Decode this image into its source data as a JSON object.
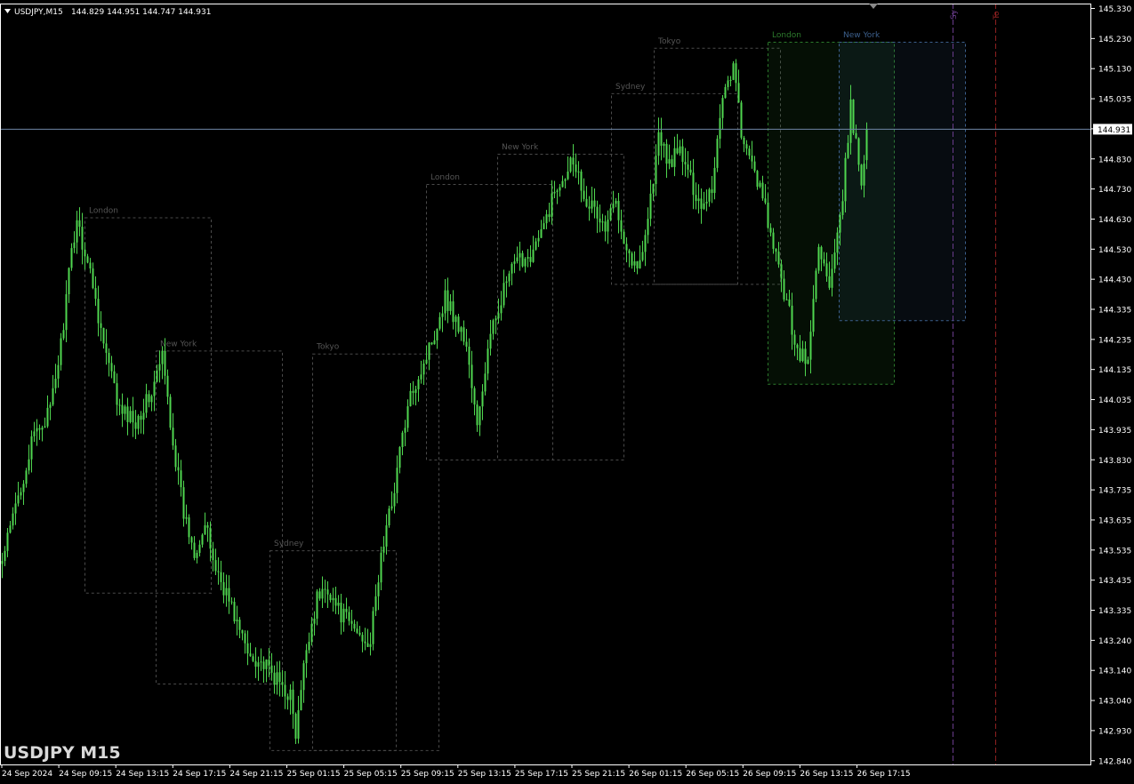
{
  "header": {
    "symbol_tf": "USDJPY,M15",
    "ohlc": "144.829 144.951 144.747 144.931"
  },
  "watermark": "USDJPY M15",
  "colors": {
    "background": "#000000",
    "candle": "#4fd64f",
    "grid_frame": "#ffffff",
    "price_line": "#6f86a6",
    "session_box": "#4a4a4a",
    "london_active": "#2c7a2c",
    "newyork_active": "#3c5f8c",
    "sydney_marker": "#6a3c8c",
    "tokyo_marker": "#8c2020"
  },
  "price_axis": {
    "labels": [
      "145.330",
      "145.230",
      "145.130",
      "145.035",
      "144.935",
      "144.830",
      "144.730",
      "144.630",
      "144.530",
      "144.430",
      "144.335",
      "144.235",
      "144.135",
      "144.035",
      "143.935",
      "143.830",
      "143.735",
      "143.635",
      "143.535",
      "143.435",
      "143.335",
      "143.240",
      "143.140",
      "143.040",
      "142.930",
      "142.840"
    ],
    "current_price": "144.931"
  },
  "time_axis": {
    "labels": [
      "24 Sep 2024",
      "24 Sep 09:15",
      "24 Sep 13:15",
      "24 Sep 17:15",
      "24 Sep 21:15",
      "25 Sep 01:15",
      "25 Sep 05:15",
      "25 Sep 09:15",
      "25 Sep 13:15",
      "25 Sep 17:15",
      "25 Sep 21:15",
      "26 Sep 01:15",
      "26 Sep 05:15",
      "26 Sep 09:15",
      "26 Sep 13:15",
      "26 Sep 17:15"
    ]
  },
  "sessions": [
    {
      "name": "London",
      "high": 144.64,
      "low": 143.4,
      "state": "past"
    },
    {
      "name": "New York",
      "high": 144.2,
      "low": 143.1,
      "state": "past"
    },
    {
      "name": "Sydney",
      "high": 143.54,
      "low": 142.88,
      "state": "past"
    },
    {
      "name": "Tokyo",
      "high": 144.19,
      "low": 142.88,
      "state": "past"
    },
    {
      "name": "London",
      "high": 144.75,
      "low": 143.84,
      "state": "past"
    },
    {
      "name": "New York",
      "high": 144.85,
      "low": 143.84,
      "state": "past"
    },
    {
      "name": "Sydney",
      "high": 145.05,
      "low": 144.42,
      "state": "past"
    },
    {
      "name": "Tokyo",
      "high": 145.2,
      "low": 144.42,
      "state": "past"
    },
    {
      "name": "London",
      "high": 145.22,
      "low": 144.09,
      "state": "current"
    },
    {
      "name": "New York",
      "high": 145.22,
      "low": 144.3,
      "state": "current"
    }
  ],
  "future_markers": [
    "Sy",
    "To"
  ],
  "chart_data": {
    "type": "candlestick",
    "symbol": "USDJPY",
    "timeframe": "M15",
    "ylim": [
      142.84,
      145.33
    ],
    "last_close": 144.931,
    "last_bar": {
      "open": 144.829,
      "high": 144.951,
      "low": 144.747,
      "close": 144.931
    },
    "close_path": [
      [
        0,
        143.5
      ],
      [
        6,
        143.72
      ],
      [
        12,
        143.92
      ],
      [
        18,
        144.0
      ],
      [
        22,
        144.22
      ],
      [
        26,
        144.52
      ],
      [
        28,
        144.64
      ],
      [
        30,
        144.56
      ],
      [
        34,
        144.42
      ],
      [
        38,
        144.22
      ],
      [
        44,
        144.0
      ],
      [
        50,
        143.97
      ],
      [
        56,
        144.06
      ],
      [
        60,
        144.18
      ],
      [
        64,
        143.9
      ],
      [
        68,
        143.66
      ],
      [
        72,
        143.54
      ],
      [
        76,
        143.62
      ],
      [
        80,
        143.48
      ],
      [
        84,
        143.4
      ],
      [
        88,
        143.3
      ],
      [
        92,
        143.2
      ],
      [
        96,
        143.18
      ],
      [
        100,
        143.14
      ],
      [
        104,
        143.1
      ],
      [
        108,
        143.06
      ],
      [
        110,
        142.92
      ],
      [
        114,
        143.22
      ],
      [
        118,
        143.38
      ],
      [
        122,
        143.42
      ],
      [
        126,
        143.34
      ],
      [
        130,
        143.3
      ],
      [
        134,
        143.26
      ],
      [
        138,
        143.24
      ],
      [
        142,
        143.52
      ],
      [
        146,
        143.7
      ],
      [
        150,
        143.92
      ],
      [
        154,
        144.08
      ],
      [
        158,
        144.16
      ],
      [
        162,
        144.26
      ],
      [
        166,
        144.38
      ],
      [
        170,
        144.3
      ],
      [
        174,
        144.22
      ],
      [
        178,
        143.94
      ],
      [
        182,
        144.2
      ],
      [
        186,
        144.35
      ],
      [
        190,
        144.45
      ],
      [
        194,
        144.5
      ],
      [
        198,
        144.52
      ],
      [
        202,
        144.58
      ],
      [
        206,
        144.7
      ],
      [
        210,
        144.78
      ],
      [
        214,
        144.84
      ],
      [
        218,
        144.72
      ],
      [
        222,
        144.66
      ],
      [
        226,
        144.6
      ],
      [
        230,
        144.7
      ],
      [
        234,
        144.54
      ],
      [
        238,
        144.46
      ],
      [
        242,
        144.64
      ],
      [
        246,
        144.9
      ],
      [
        250,
        144.82
      ],
      [
        254,
        144.86
      ],
      [
        258,
        144.76
      ],
      [
        262,
        144.68
      ],
      [
        266,
        144.74
      ],
      [
        270,
        145.05
      ],
      [
        274,
        145.14
      ],
      [
        278,
        144.86
      ],
      [
        282,
        144.8
      ],
      [
        286,
        144.66
      ],
      [
        290,
        144.5
      ],
      [
        294,
        144.36
      ],
      [
        298,
        144.2
      ],
      [
        302,
        144.16
      ],
      [
        306,
        144.56
      ],
      [
        310,
        144.4
      ],
      [
        314,
        144.62
      ],
      [
        318,
        145.0
      ],
      [
        322,
        144.76
      ],
      [
        324,
        144.931
      ]
    ]
  }
}
